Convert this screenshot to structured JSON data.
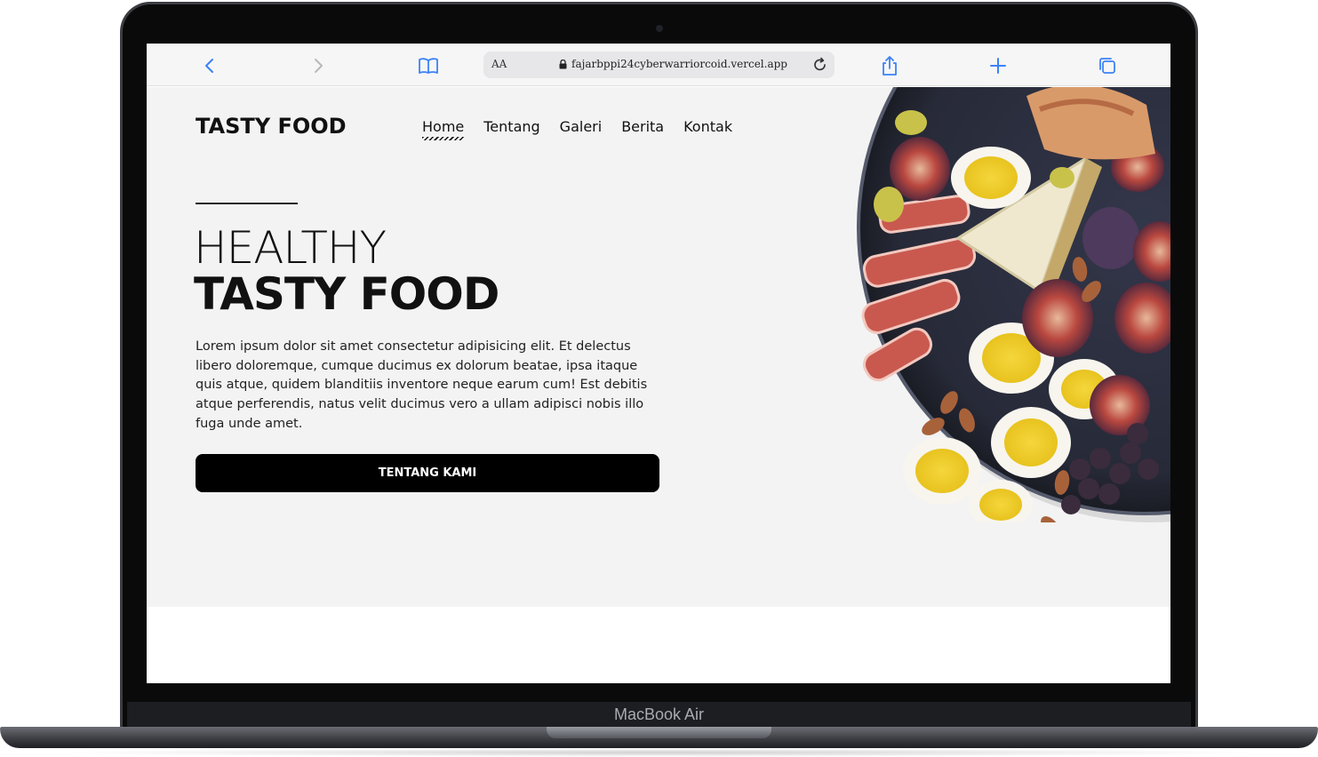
{
  "device": {
    "brand_label": "MacBook Air"
  },
  "browser": {
    "address_text_size": "AA",
    "url": "fajarbppi24cyberwarriorcoid.vercel.app",
    "icons": [
      "back-icon",
      "forward-icon",
      "bookmarks-icon",
      "lock-icon",
      "reload-icon",
      "share-icon",
      "new-tab-icon",
      "tabs-icon"
    ]
  },
  "site": {
    "logo": "TASTY FOOD",
    "nav": [
      {
        "label": "Home",
        "active": true
      },
      {
        "label": "Tentang"
      },
      {
        "label": "Galeri"
      },
      {
        "label": "Berita"
      },
      {
        "label": "Kontak"
      }
    ],
    "hero": {
      "headline_thin": "HEALTHY",
      "headline_bold": "TASTY FOOD",
      "paragraph": "Lorem ipsum dolor sit amet consectetur adipisicing elit. Et delectus libero doloremque, cumque ducimus ex dolorum beatae, ipsa itaque quis atque, quidem blanditiis inventore neque earum cum! Est debitis atque perferendis, natus velit ducimus vero a ullam adipisci nobis illo fuga unde amet.",
      "cta_label": "TENTANG KAMI",
      "image": "food-plate-image"
    }
  },
  "colors": {
    "accent": "#000000",
    "page_bg": "#f3f3f3",
    "link_blue": "#3b82f6"
  }
}
